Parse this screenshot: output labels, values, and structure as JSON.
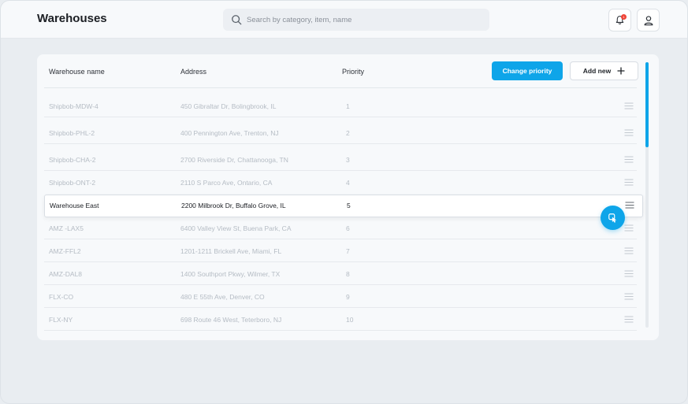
{
  "header": {
    "title": "Warehouses",
    "search_placeholder": "Search by category, item, name",
    "notification_count": "1"
  },
  "table": {
    "columns": [
      "Warehouse name",
      "Address",
      "Priority"
    ],
    "change_priority_label": "Change priority",
    "add_new_label": "Add new",
    "rows": [
      {
        "name": "Shipbob-MDW-4",
        "address": "450 Gibraltar Dr, Bolingbrook, IL",
        "priority": "1"
      },
      {
        "name": "Shipbob-PHL-2",
        "address": "400 Pennington Ave, Trenton, NJ",
        "priority": "2"
      },
      {
        "name": "Shipbob-CHA-2",
        "address": "2700 Riverside Dr, Chattanooga, TN",
        "priority": "3"
      },
      {
        "name": "Shipbob-ONT-2",
        "address": "2110 S Parco Ave, Ontario, CA",
        "priority": "4"
      },
      {
        "name": "Warehouse East",
        "address": "2200 Milbrook Dr, Buffalo Grove, IL",
        "priority": "5",
        "active": true
      },
      {
        "name": "AMZ -LAX5",
        "address": "6400 Valley View St, Buena Park, CA",
        "priority": "6"
      },
      {
        "name": "AMZ-FFL2",
        "address": "1201-1211 Brickell Ave, Miami, FL",
        "priority": "7"
      },
      {
        "name": "AMZ-DAL8",
        "address": "1400 Southport Pkwy, Wilmer, TX",
        "priority": "8"
      },
      {
        "name": "FLX-CO",
        "address": "480 E 55th Ave, Denver, CO",
        "priority": "9"
      },
      {
        "name": "FLX-NY",
        "address": "698 Route 46 West, Teterboro, NJ",
        "priority": "10"
      }
    ]
  },
  "colors": {
    "accent": "#0ea5e9",
    "background": "#e9edf1",
    "card": "#f7f9fb",
    "muted_text": "#b5bcc4",
    "active_text": "#1c1f24"
  }
}
